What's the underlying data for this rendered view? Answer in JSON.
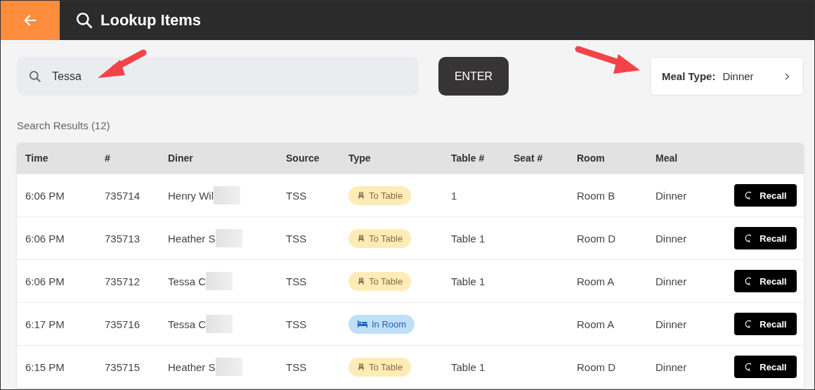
{
  "header": {
    "title": "Lookup Items"
  },
  "search": {
    "value": "Tessa"
  },
  "enter_button": "ENTER",
  "meal_type": {
    "label": "Meal Type:",
    "value": "Dinner"
  },
  "results_label": "Search Results (12)",
  "table": {
    "columns": [
      "Time",
      "#",
      "Diner",
      "Source",
      "Type",
      "Table #",
      "Seat #",
      "Room",
      "Meal"
    ],
    "rows": [
      {
        "time": "6:06 PM",
        "number": "735714",
        "diner": "Henry Wil",
        "redacted": true,
        "source": "TSS",
        "type": {
          "kind": "to_table",
          "label": "To Table"
        },
        "table": "1",
        "seat": "",
        "room": "Room B",
        "meal": "Dinner",
        "action": "Recall"
      },
      {
        "time": "6:06 PM",
        "number": "735713",
        "diner": "Heather S",
        "redacted": true,
        "source": "TSS",
        "type": {
          "kind": "to_table",
          "label": "To Table"
        },
        "table": "Table 1",
        "seat": "",
        "room": "Room D",
        "meal": "Dinner",
        "action": "Recall"
      },
      {
        "time": "6:06 PM",
        "number": "735712",
        "diner": "Tessa C",
        "redacted": true,
        "source": "TSS",
        "type": {
          "kind": "to_table",
          "label": "To Table"
        },
        "table": "Table 1",
        "seat": "",
        "room": "Room A",
        "meal": "Dinner",
        "action": "Recall"
      },
      {
        "time": "6:17 PM",
        "number": "735716",
        "diner": "Tessa C",
        "redacted": true,
        "source": "TSS",
        "type": {
          "kind": "in_room",
          "label": "In Room"
        },
        "table": "",
        "seat": "",
        "room": "Room A",
        "meal": "Dinner",
        "action": "Recall"
      },
      {
        "time": "6:15 PM",
        "number": "735715",
        "diner": "Heather S",
        "redacted": true,
        "source": "TSS",
        "type": {
          "kind": "to_table",
          "label": "To Table"
        },
        "table": "Table 1",
        "seat": "",
        "room": "Room D",
        "meal": "Dinner",
        "action": "Recall"
      }
    ]
  }
}
